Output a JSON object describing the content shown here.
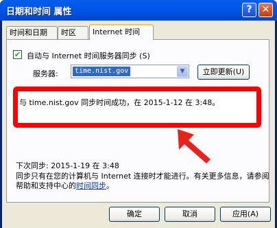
{
  "window": {
    "title": "日期和时间 属性",
    "help_label": "?",
    "close_label": "✕"
  },
  "tabs": [
    {
      "label": "时间和日期"
    },
    {
      "label": "时区"
    },
    {
      "label": "Internet 时间"
    }
  ],
  "internet": {
    "auto_sync_label": "自动与 Internet 时间服务器同步 (S)",
    "auto_sync_checked": true,
    "server_label": "服务器:",
    "server_value": "time.nist.gov",
    "update_button": "立即更新(U)",
    "status_message": "与 time.nist.gov 同步时间成功，在 2015-1-12 在 3:48。",
    "next_sync": "下次同步: 2015-1-19 在 3:48",
    "note_text": "同步只有在您的计算机与 Internet 连接时才能进行。有关更多信息，请参阅帮助和支持中心的",
    "note_link": "时间同步",
    "note_end": "。"
  },
  "buttons": {
    "ok": "确定",
    "cancel": "取消",
    "apply": "应用(A)"
  },
  "colors": {
    "highlight_box": "#ff0000",
    "titlebar": "#0058ee"
  }
}
